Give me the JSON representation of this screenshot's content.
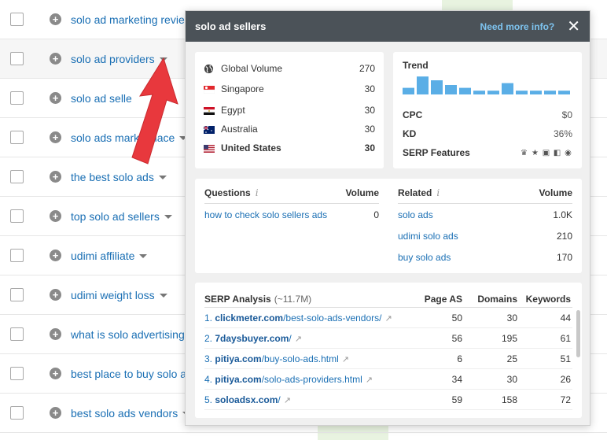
{
  "keywords": [
    {
      "text": "solo ad marketing revie",
      "caret": false
    },
    {
      "text": "solo ad providers",
      "caret": true
    },
    {
      "text": "solo ad selle",
      "caret": false
    },
    {
      "text": "solo ads marketplace",
      "caret": true
    },
    {
      "text": "the best solo ads",
      "caret": true
    },
    {
      "text": "top solo ad sellers",
      "caret": true
    },
    {
      "text": "udimi affiliate",
      "caret": true
    },
    {
      "text": "udimi weight loss",
      "caret": true
    },
    {
      "text": "what is solo advertising",
      "caret": false
    },
    {
      "text": "best place to buy solo a",
      "caret": false
    },
    {
      "text": "best solo ads vendors",
      "caret": true
    }
  ],
  "popup": {
    "title": "solo ad sellers",
    "more_info": "Need more info?",
    "close": "✕",
    "volume": {
      "global_label": "Global Volume",
      "global_value": "270",
      "countries": [
        {
          "name": "Singapore",
          "value": "30",
          "flag": "sg",
          "bold": false
        },
        {
          "name": "Egypt",
          "value": "30",
          "flag": "eg",
          "bold": false
        },
        {
          "name": "Australia",
          "value": "30",
          "flag": "au",
          "bold": false
        },
        {
          "name": "United States",
          "value": "30",
          "flag": "us",
          "bold": true
        }
      ]
    },
    "trend": {
      "label": "Trend",
      "bars": [
        0.35,
        0.95,
        0.75,
        0.5,
        0.35,
        0.2,
        0.2,
        0.6,
        0.2,
        0.2,
        0.2,
        0.2
      ],
      "cpc_label": "CPC",
      "cpc_value": "$0",
      "kd_label": "KD",
      "kd_value": "36%",
      "serp_features_label": "SERP Features",
      "serp_features": [
        "crown-icon",
        "star-icon",
        "video-icon",
        "image-icon",
        "play-icon"
      ]
    },
    "questions": {
      "label": "Questions",
      "info": "i",
      "volume_label": "Volume",
      "rows": [
        {
          "text": "how to check solo sellers ads",
          "volume": "0"
        }
      ]
    },
    "related": {
      "label": "Related",
      "info": "i",
      "volume_label": "Volume",
      "rows": [
        {
          "text": "solo ads",
          "volume": "1.0K"
        },
        {
          "text": "udimi solo ads",
          "volume": "210"
        },
        {
          "text": "buy solo ads",
          "volume": "170"
        }
      ]
    },
    "serp": {
      "label": "SERP Analysis",
      "sub": "(~11.7M)",
      "col_pa": "Page AS",
      "col_dm": "Domains",
      "col_kw": "Keywords",
      "rows": [
        {
          "n": "1.",
          "domain": "clickmeter.com",
          "path": "/best-solo-ads-vendors/",
          "pa": "50",
          "dm": "30",
          "kw": "44"
        },
        {
          "n": "2.",
          "domain": "7daysbuyer.com",
          "path": "/",
          "pa": "56",
          "dm": "195",
          "kw": "61"
        },
        {
          "n": "3.",
          "domain": "pitiya.com",
          "path": "/buy-solo-ads.html",
          "pa": "6",
          "dm": "25",
          "kw": "51"
        },
        {
          "n": "4.",
          "domain": "pitiya.com",
          "path": "/solo-ads-providers.html",
          "pa": "34",
          "dm": "30",
          "kw": "26"
        },
        {
          "n": "5.",
          "domain": "soloadsx.com",
          "path": "/",
          "pa": "59",
          "dm": "158",
          "kw": "72"
        }
      ]
    }
  },
  "colors": {
    "link": "#1a6fb4",
    "header": "#4b5258",
    "bar": "#5aaee6",
    "arrow": "#e8383d"
  }
}
